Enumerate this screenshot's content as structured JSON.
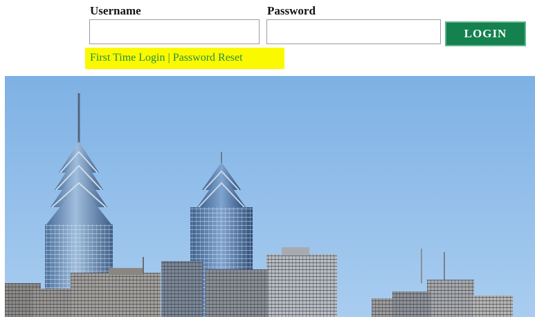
{
  "login": {
    "username_label": "Username",
    "password_label": "Password",
    "username_value": "",
    "password_value": "",
    "login_button_label": "LOGIN"
  },
  "links": {
    "first_time_login": "First Time Login",
    "separator": "|",
    "password_reset": "Password Reset"
  },
  "hero": {
    "subject": "city-skyline-photo"
  },
  "colors": {
    "login_button": "#14814e",
    "link_text": "#24903d",
    "highlight": "#fbf900",
    "sky": "#8fbde9"
  }
}
